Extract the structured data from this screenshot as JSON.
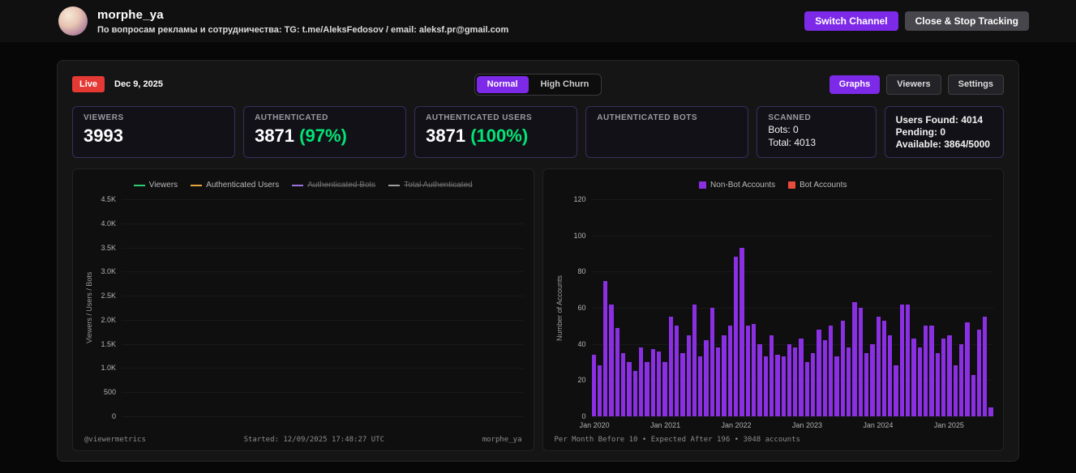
{
  "theme": {
    "accent": "#7d2ae8",
    "green": "#00e676",
    "live_red": "#e53935",
    "bar_purple": "#8b2fe2"
  },
  "header": {
    "username": "morphe_ya",
    "subtitle": "По вопросам рекламы и сотрудничества: TG: t.me/AleksFedosov / email: aleksf.pr@gmail.com",
    "switch_channel_label": "Switch Channel",
    "close_stop_label": "Close & Stop Tracking"
  },
  "toolbar": {
    "live_label": "Live",
    "date": "Dec 9, 2025",
    "mode_normal": "Normal",
    "mode_high_churn": "High Churn",
    "tab_graphs": "Graphs",
    "tab_viewers": "Viewers",
    "tab_settings": "Settings"
  },
  "stats": {
    "viewers": {
      "label": "VIEWERS",
      "value": "3993"
    },
    "authenticated": {
      "label": "AUTHENTICATED",
      "value": "3871",
      "percent": "(97%)"
    },
    "authenticated_users": {
      "label": "AUTHENTICATED USERS",
      "value": "3871",
      "percent": "(100%)"
    },
    "authenticated_bots": {
      "label": "AUTHENTICATED BOTS",
      "value": ""
    },
    "scanned": {
      "label": "SCANNED",
      "bots": "Bots: 0",
      "total": "Total: 4013"
    },
    "capacity": {
      "users_found": "Users Found: 4014",
      "pending": "Pending: 0",
      "available": "Available: 3864/5000"
    }
  },
  "chart_data": [
    {
      "type": "line",
      "title": "",
      "ylabel": "Viewers / Users / Bots",
      "ylim": [
        0,
        4500
      ],
      "yticks_top_to_bottom": [
        "4.5K",
        "4.0K",
        "3.5K",
        "3.0K",
        "2.5K",
        "2.0K",
        "1.5K",
        "1.0K",
        "500",
        "0"
      ],
      "legend": [
        {
          "label": "Viewers",
          "color": "#2ecc71",
          "active": true
        },
        {
          "label": "Authenticated Users",
          "color": "#e8a33d",
          "active": true
        },
        {
          "label": "Authenticated Bots",
          "color": "#9b72d8",
          "active": false
        },
        {
          "label": "Total Authenticated",
          "color": "#9e9e9e",
          "active": false
        }
      ],
      "series": [],
      "footer_left": "@viewermetrics",
      "footer_center": "Started: 12/09/2025 17:48:27 UTC",
      "footer_right": "morphe_ya"
    },
    {
      "type": "bar",
      "title": "",
      "ylabel": "Number of Accounts",
      "ylim": [
        0,
        120
      ],
      "yticks": [
        0,
        20,
        40,
        60,
        80,
        100,
        120
      ],
      "legend": [
        {
          "label": "Non-Bot Accounts",
          "color": "#8b2fe2",
          "active": true
        },
        {
          "label": "Bot Accounts",
          "color": "#e74c3c",
          "active": true
        }
      ],
      "xticks": [
        "Jan 2020",
        "Jan 2021",
        "Jan 2022",
        "Jan 2023",
        "Jan 2024",
        "Jan 2025"
      ],
      "xtick_positions": [
        0,
        12,
        24,
        36,
        48,
        60
      ],
      "values": [
        34,
        28,
        75,
        62,
        49,
        35,
        30,
        25,
        38,
        30,
        37,
        36,
        30,
        55,
        50,
        35,
        45,
        62,
        33,
        42,
        60,
        38,
        45,
        50,
        88,
        93,
        50,
        51,
        40,
        33,
        45,
        34,
        33,
        40,
        38,
        43,
        30,
        35,
        48,
        42,
        50,
        33,
        53,
        38,
        63,
        60,
        35,
        40,
        55,
        53,
        45,
        28,
        62,
        62,
        43,
        38,
        50,
        50,
        35,
        43,
        45,
        28,
        40,
        52,
        23,
        48,
        55,
        5
      ],
      "footer": "Per Month Before 10 • Expected After 196 • 3048 accounts"
    }
  ]
}
